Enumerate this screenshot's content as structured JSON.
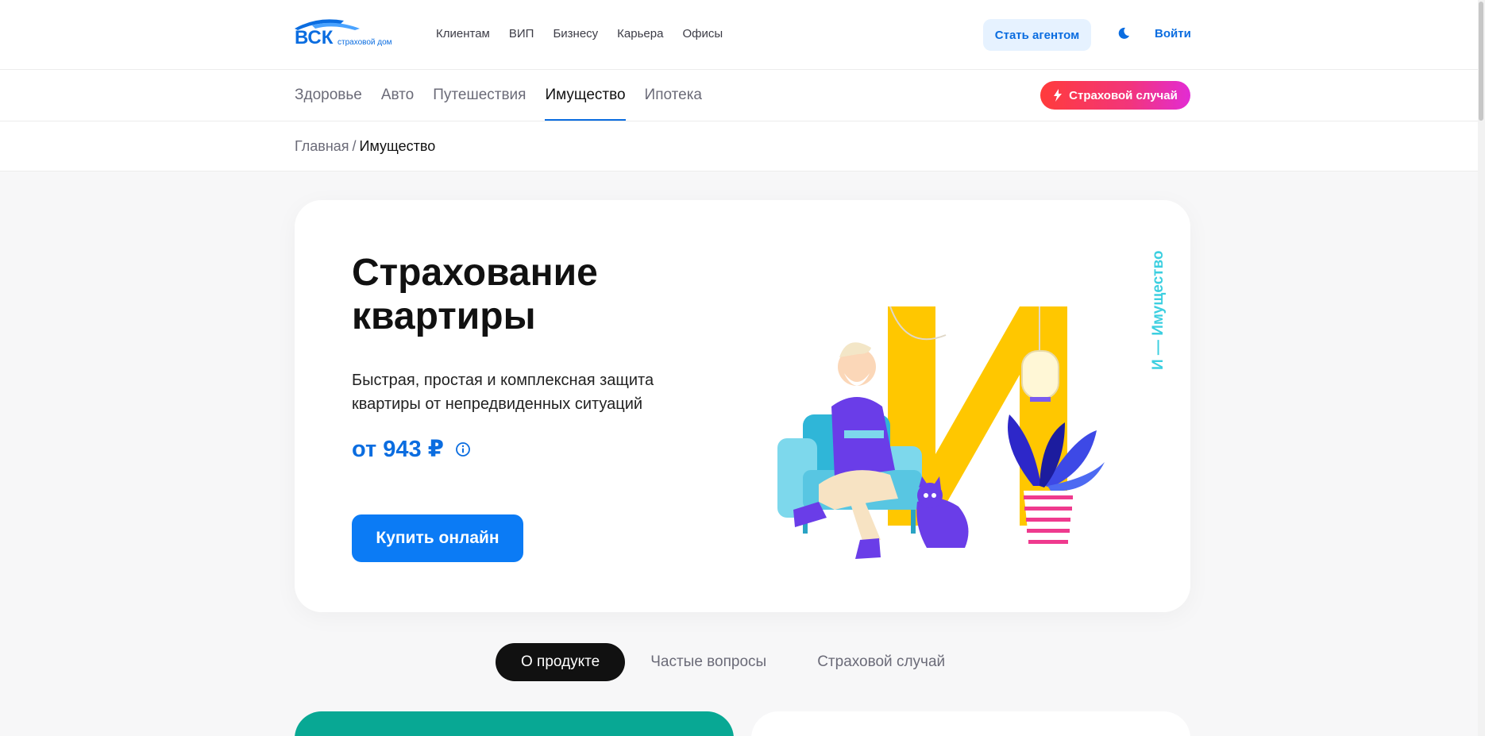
{
  "logo": {
    "text": "ВСК",
    "subtitle": "страховой дом",
    "icon": "vsk-roof-logo"
  },
  "topnav": {
    "items": [
      "Клиентам",
      "ВИП",
      "Бизнесу",
      "Карьера",
      "Офисы"
    ],
    "agent_label": "Стать агентом",
    "theme_icon": "moon-icon",
    "login_label": "Войти"
  },
  "categories": {
    "items": [
      "Здоровье",
      "Авто",
      "Путешествия",
      "Имущество",
      "Ипотека"
    ],
    "active": "Имущество",
    "claim_label": "Страховой случай",
    "claim_icon": "lightning-icon"
  },
  "breadcrumb": {
    "home": "Главная",
    "separator": "/",
    "current": "Имущество"
  },
  "hero": {
    "title": "Страхование квартиры",
    "description": "Быстрая, простая и комплексная защита квартиры от непредвиденных ситуаций",
    "price": "от 943 ₽",
    "buy_label": "Купить онлайн",
    "vertical_label": "И — Имущество",
    "illustration": "man-reading-in-armchair-with-cat"
  },
  "tabs": {
    "items": [
      "О продукте",
      "Частые вопросы",
      "Страховой случай"
    ],
    "active": "О продукте"
  },
  "colors": {
    "brand_blue": "#0b6de0",
    "button_blue": "#0b7bf5",
    "claim_gradient_start": "#ff3b3b",
    "claim_gradient_end": "#e22cd4",
    "teal": "#08a894",
    "accent_yellow": "#ffc700"
  }
}
